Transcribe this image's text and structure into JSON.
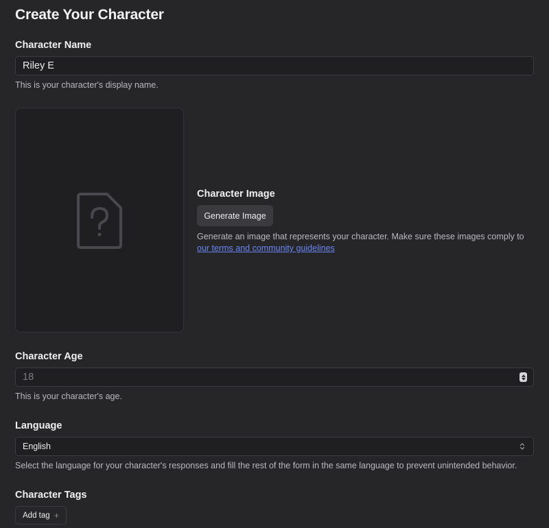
{
  "page": {
    "title": "Create Your Character"
  },
  "name_section": {
    "label": "Character Name",
    "value": "Riley E",
    "hint": "This is your character's display name."
  },
  "image_section": {
    "label": "Character Image",
    "placeholder_icon": "image-question-file-icon",
    "button_label": "Generate Image",
    "description": "Generate an image that represents your character. Make sure these images comply to ",
    "link_text": "our terms and community guidelines"
  },
  "age_section": {
    "label": "Character Age",
    "placeholder": "18",
    "hint": "This is your character's age."
  },
  "language_section": {
    "label": "Language",
    "selected": "English",
    "hint": "Select the language for your character's responses and fill the rest of the form in the same language to prevent unintended behavior."
  },
  "tags_section": {
    "label": "Character Tags",
    "add_button_label": "Add tag"
  }
}
